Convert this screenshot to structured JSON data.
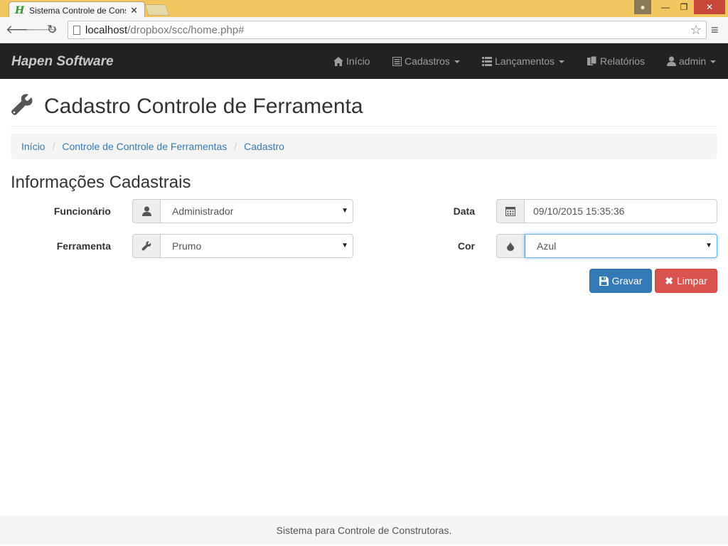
{
  "browser": {
    "tab_title": "Sistema Controle de Cons",
    "tab_favicon": "H",
    "url_host": "localhost",
    "url_path": "/dropbox/scc/home.php#",
    "icons": [
      "back-arrow-icon",
      "forward-arrow-icon",
      "reload-icon",
      "page-icon",
      "star-icon",
      "menu-icon",
      "user-icon",
      "minimize-icon",
      "maximize-icon",
      "close-icon"
    ]
  },
  "navbar": {
    "brand": "Hapen Software",
    "items": [
      {
        "label": "Início",
        "icon": "home-icon"
      },
      {
        "label": "Cadastros",
        "icon": "list-alt-icon"
      },
      {
        "label": "Lançamentos",
        "icon": "th-list-icon"
      },
      {
        "label": "Relatórios",
        "icon": "documents-icon"
      },
      {
        "label": "admin",
        "icon": "user-icon"
      }
    ]
  },
  "page": {
    "title": "Cadastro Controle de Ferramenta",
    "title_icon": "wrench-icon",
    "breadcrumb": [
      "Início",
      "Controle de Controle de Ferramentas",
      "Cadastro"
    ],
    "section_title": "Informações Cadastrais"
  },
  "form": {
    "funcionario_label": "Funcionário",
    "funcionario_value": "Administrador",
    "ferramenta_label": "Ferramenta",
    "ferramenta_value": "Prumo",
    "data_label": "Data",
    "data_value": "09/10/2015 15:35:36",
    "cor_label": "Cor",
    "cor_value": "Azul",
    "save_label": "Gravar",
    "clear_label": "Limpar"
  },
  "footer": {
    "text": "Sistema para Controle de Construtoras."
  },
  "colors": {
    "navbar_bg": "#222222",
    "primary": "#337ab7",
    "danger": "#d9534f",
    "titlebar": "#f3c760"
  }
}
